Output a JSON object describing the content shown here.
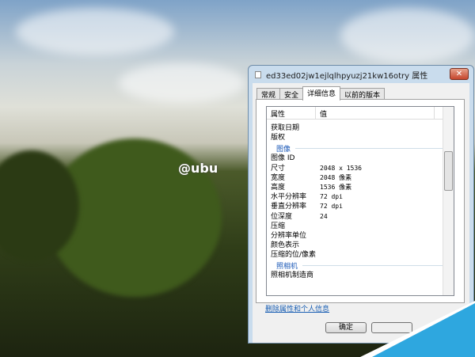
{
  "watermark": "@ubu",
  "dialog": {
    "title": "ed33ed02jw1ejlqlhpyuzj21kw16otry 属性",
    "close": "✕",
    "tabs": [
      "常规",
      "安全",
      "详细信息",
      "以前的版本"
    ],
    "columns": [
      "属性",
      "值"
    ],
    "rows_top": [
      {
        "k": "获取日期",
        "v": ""
      },
      {
        "k": "版权",
        "v": ""
      }
    ],
    "group_image": "图像",
    "rows_image": [
      {
        "k": "图像 ID",
        "v": ""
      },
      {
        "k": "尺寸",
        "v": "2048 x 1536"
      },
      {
        "k": "宽度",
        "v": "2048 像素"
      },
      {
        "k": "高度",
        "v": "1536 像素"
      },
      {
        "k": "水平分辨率",
        "v": "72 dpi"
      },
      {
        "k": "垂直分辨率",
        "v": "72 dpi"
      },
      {
        "k": "位深度",
        "v": "24"
      },
      {
        "k": "压缩",
        "v": ""
      },
      {
        "k": "分辨率单位",
        "v": ""
      },
      {
        "k": "颜色表示",
        "v": ""
      },
      {
        "k": "压缩的位/像素",
        "v": ""
      }
    ],
    "group_camera": "照相机",
    "rows_camera": [
      {
        "k": "照相机制造商",
        "v": ""
      }
    ],
    "link": "删除属性和个人信息",
    "ok": "确定"
  }
}
